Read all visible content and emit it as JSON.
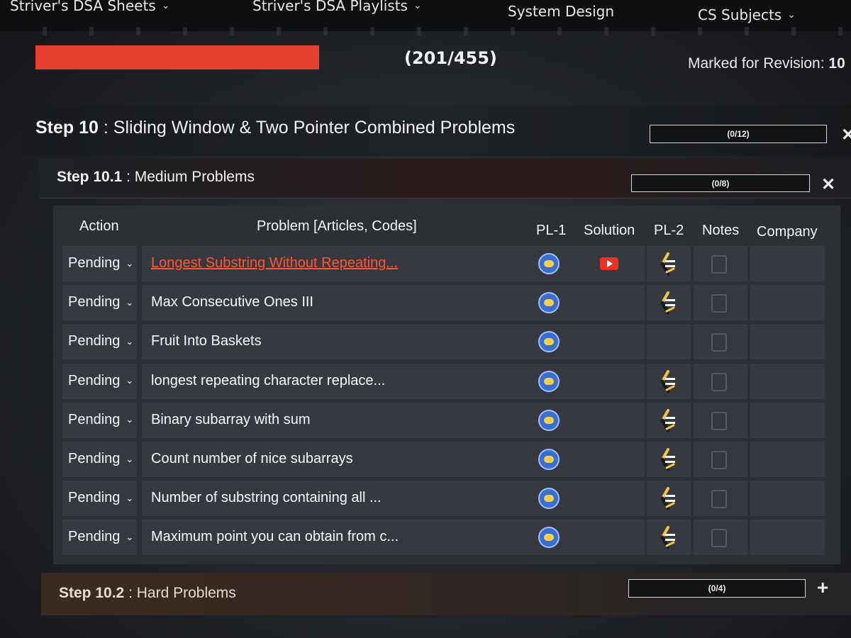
{
  "nav": {
    "items": [
      {
        "label": "Striver's DSA Sheets",
        "has_chevron": true
      },
      {
        "label": "Striver's DSA Playlists",
        "has_chevron": true
      },
      {
        "label": "System Design",
        "has_chevron": false
      },
      {
        "label": "CS Subjects",
        "has_chevron": true
      }
    ]
  },
  "progress": {
    "text": "(201/455)",
    "completed": 201,
    "total": 455,
    "bar_color": "#e4402d"
  },
  "revision": {
    "label": "Marked for Revision:",
    "count": "10"
  },
  "step": {
    "prefix": "Step 10",
    "title": ": Sliding Window & Two Pointer Combined Problems",
    "progress": "(0/12)"
  },
  "substep1": {
    "prefix": "Step 10.1",
    "title": ": Medium Problems",
    "progress": "(0/8)"
  },
  "table": {
    "headers": {
      "action": "Action",
      "problem": "Problem [Articles, Codes]",
      "pl1": "PL-1",
      "solution": "Solution",
      "pl2": "PL-2",
      "notes": "Notes",
      "company": "Company"
    },
    "rows": [
      {
        "status": "Pending",
        "problem": "Longest Substring Without Repeating...",
        "is_link": true,
        "pl1": "leetcode-icon",
        "solution": "youtube-icon",
        "pl2": "codingninjas-icon",
        "notes": "note-icon"
      },
      {
        "status": "Pending",
        "problem": "Max Consecutive Ones III",
        "is_link": false,
        "pl1": "leetcode-icon",
        "solution": "",
        "pl2": "codingninjas-icon",
        "notes": "note-icon"
      },
      {
        "status": "Pending",
        "problem": "Fruit Into Baskets",
        "is_link": false,
        "pl1": "leetcode-icon",
        "solution": "",
        "pl2": "",
        "notes": "note-icon"
      },
      {
        "status": "Pending",
        "problem": "longest repeating character replace...",
        "is_link": false,
        "pl1": "leetcode-icon",
        "solution": "",
        "pl2": "codingninjas-icon",
        "notes": "note-icon"
      },
      {
        "status": "Pending",
        "problem": "Binary subarray with sum",
        "is_link": false,
        "pl1": "leetcode-icon",
        "solution": "",
        "pl2": "codingninjas-icon",
        "notes": "note-icon"
      },
      {
        "status": "Pending",
        "problem": "Count number of nice subarrays",
        "is_link": false,
        "pl1": "leetcode-icon",
        "solution": "",
        "pl2": "codingninjas-icon",
        "notes": "note-icon"
      },
      {
        "status": "Pending",
        "problem": "Number of substring containing all ...",
        "is_link": false,
        "pl1": "leetcode-icon",
        "solution": "",
        "pl2": "codingninjas-icon",
        "notes": "note-icon"
      },
      {
        "status": "Pending",
        "problem": "Maximum point you can obtain from c...",
        "is_link": false,
        "pl1": "leetcode-icon",
        "solution": "",
        "pl2": "codingninjas-icon",
        "notes": "note-icon"
      }
    ]
  },
  "substep2": {
    "prefix": "Step 10.2",
    "title": ": Hard Problems",
    "progress": "(0/4)"
  }
}
